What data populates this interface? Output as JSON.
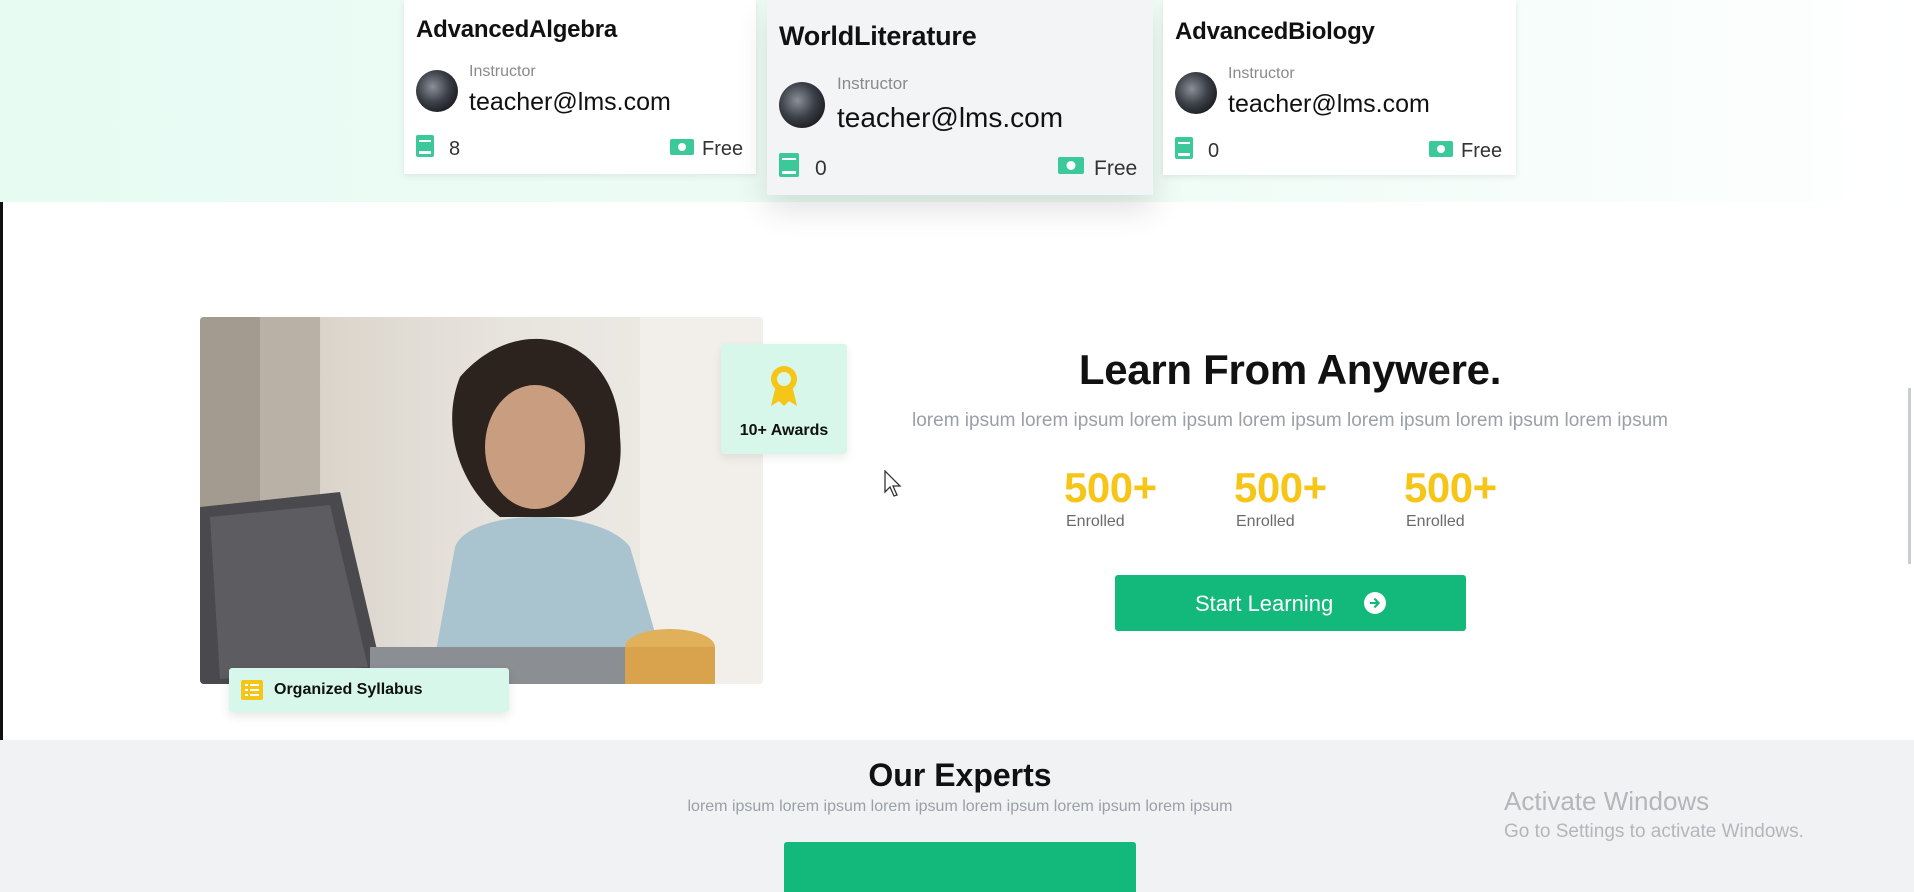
{
  "courses": [
    {
      "title": "AdvancedAlgebra",
      "instructor_label": "Instructor",
      "email": "teacher@lms.com",
      "lessons": "8",
      "price": "Free"
    },
    {
      "title": "WorldLiterature",
      "instructor_label": "Instructor",
      "email": "teacher@lms.com",
      "lessons": "0",
      "price": "Free"
    },
    {
      "title": "AdvancedBiology",
      "instructor_label": "Instructor",
      "email": "teacher@lms.com",
      "lessons": "0",
      "price": "Free"
    }
  ],
  "hero": {
    "award_label": "10+ Awards",
    "syllabus_label": "Organized Syllabus",
    "title": "Learn From Anywere.",
    "subtitle": "lorem ipsum lorem ipsum lorem ipsum lorem ipsum lorem ipsum lorem ipsum lorem ipsum",
    "stats": [
      {
        "value": "500+",
        "label": "Enrolled"
      },
      {
        "value": "500+",
        "label": "Enrolled"
      },
      {
        "value": "500+",
        "label": "Enrolled"
      }
    ],
    "cta_label": "Start Learning"
  },
  "experts": {
    "title": "Our Experts",
    "subtitle": "lorem ipsum lorem ipsum lorem ipsum lorem ipsum lorem ipsum lorem ipsum"
  },
  "watermark": {
    "line1": "Activate Windows",
    "line2": "Go to Settings to activate Windows."
  },
  "colors": {
    "accent": "#12b97b",
    "stat": "#f5c518",
    "badge_bg": "#d6f7ea"
  },
  "icons": [
    "book-icon",
    "money-icon",
    "award-ribbon-icon",
    "list-icon",
    "arrow-circle-right-icon"
  ]
}
